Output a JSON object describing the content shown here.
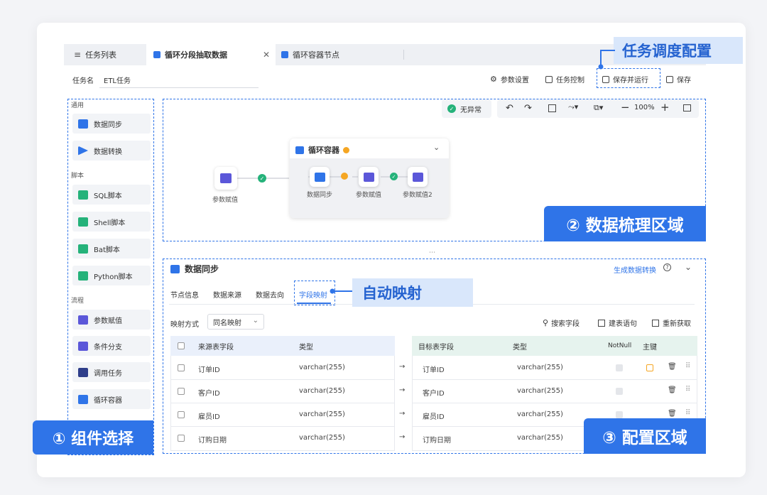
{
  "tabs": {
    "task_list": "任务列表",
    "active": "循环分段抽取数据",
    "other": "循环容器节点"
  },
  "task_name": {
    "label": "任务名",
    "value": "ETL任务"
  },
  "toolbar": {
    "params": "参数设置",
    "control": "任务控制",
    "save_run": "保存并运行",
    "save": "保存"
  },
  "callouts": {
    "schedule": "任务调度配置",
    "canvas": "② 数据梳理区域",
    "components": "① 组件选择",
    "config": "③ 配置区域",
    "automap": "自动映射"
  },
  "sidebar": {
    "groups": {
      "general": "通用",
      "script": "脚本",
      "flow": "流程"
    },
    "general_items": [
      {
        "label": "数据同步"
      },
      {
        "label": "数据转换"
      }
    ],
    "script_items": [
      {
        "label": "SQL脚本"
      },
      {
        "label": "Shell脚本"
      },
      {
        "label": "Bat脚本"
      },
      {
        "label": "Python脚本"
      }
    ],
    "flow_items": [
      {
        "label": "参数赋值"
      },
      {
        "label": "条件分支"
      },
      {
        "label": "调用任务"
      },
      {
        "label": "循环容器"
      }
    ]
  },
  "canvas_toolbar": {
    "status": "无异常",
    "zoom": "100%"
  },
  "canvas": {
    "start_node": "参数赋值",
    "container_title": "循环容器",
    "container_nodes": [
      "数据同步",
      "参数赋值",
      "参数赋值2"
    ]
  },
  "config": {
    "title": "数据同步",
    "generate_link": "生成数据转换",
    "tabs": [
      "节点信息",
      "数据来源",
      "数据去向",
      "字段映射"
    ],
    "mapping_label": "映射方式",
    "mapping_value": "同名映射",
    "actions": {
      "search": "搜索字段",
      "create": "建表语句",
      "refresh": "重新获取"
    },
    "left_headers": {
      "field": "来源表字段",
      "type": "类型"
    },
    "right_headers": {
      "field": "目标表字段",
      "type": "类型",
      "notnull": "NotNull",
      "pk": "主键"
    },
    "rows": [
      {
        "src": "订单ID",
        "src_type": "varchar(255)",
        "dst": "订单ID",
        "dst_type": "varchar(255)"
      },
      {
        "src": "客户ID",
        "src_type": "varchar(255)",
        "dst": "客户ID",
        "dst_type": "varchar(255)"
      },
      {
        "src": "雇员ID",
        "src_type": "varchar(255)",
        "dst": "雇员ID",
        "dst_type": "varchar(255)"
      },
      {
        "src": "订购日期",
        "src_type": "varchar(255)",
        "dst": "订购日期",
        "dst_type": "varchar(255)"
      }
    ]
  },
  "colors": {
    "accent": "#2f74e8",
    "success": "#25b27a",
    "warning": "#f5a623",
    "node_purple": "#5b57d9",
    "table_left_header": "#eaf0fb",
    "table_right_header": "#e6f3ee"
  }
}
